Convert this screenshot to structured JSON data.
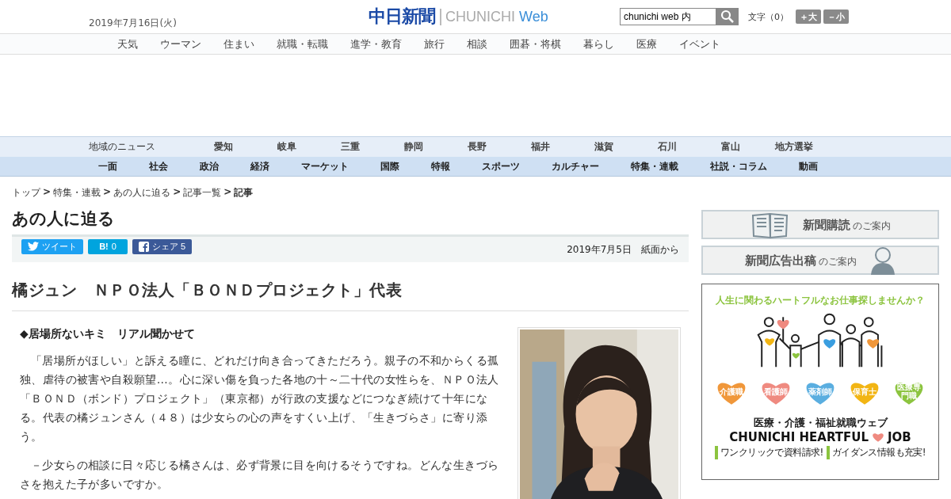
{
  "header": {
    "date": "2019年7月16日(火)",
    "logo_jp": "中日新聞",
    "logo_en": "CHUNICHI",
    "logo_web": "Web",
    "search": {
      "value": "chunichi web 内"
    },
    "font_size": {
      "label": "文字（0）",
      "bigger": "＋大",
      "smaller": "－小"
    }
  },
  "top_nav": [
    "天気",
    "ウーマン",
    "住まい",
    "就職・転職",
    "進学・教育",
    "旅行",
    "相談",
    "囲碁・将棋",
    "暮らし",
    "医療",
    "イベント"
  ],
  "region_nav": {
    "label": "地域のニュース",
    "items": [
      "愛知",
      "岐阜",
      "三重",
      "静岡",
      "長野",
      "福井",
      "滋賀",
      "石川",
      "富山",
      "地方選挙"
    ]
  },
  "category_nav": [
    "一面",
    "社会",
    "政治",
    "経済",
    "マーケット",
    "国際",
    "特報",
    "スポーツ",
    "カルチャー",
    "特集・連載",
    "社説・コラム",
    "動画"
  ],
  "breadcrumb_separator": ">",
  "breadcrumb": [
    {
      "label": "トップ",
      "current": false
    },
    {
      "label": "特集・連載",
      "current": false
    },
    {
      "label": "あの人に迫る",
      "current": false
    },
    {
      "label": "記事一覧",
      "current": false
    },
    {
      "label": "記事",
      "current": true
    }
  ],
  "section_title": "あの人に迫る",
  "share": [
    {
      "kind": "twitter",
      "label": "ツイート"
    },
    {
      "kind": "hatena",
      "label": "B!",
      "count": "0"
    },
    {
      "kind": "facebook",
      "label": "シェア",
      "count": "5"
    }
  ],
  "article_date": "2019年7月5日　紙面から",
  "headline": "橘ジュン　ＮＰＯ法人「ＢＯＮＤプロジェクト」代表",
  "subhead": "◆居場所ないキミ　リアル聞かせて",
  "paragraphs": [
    "「居場所がほしい」と訴える瞳に、どれだけ向き合ってきただろう。親子の不和からくる孤独、虐待の被害や自殺願望…。心に深い傷を負った各地の十～二十代の女性らを、ＮＰＯ法人「ＢＯＮＤ（ボンド）プロジェクト」（東京都）が行政の支援などにつなぎ続けて十年になる。代表の橘ジュンさん（４８）は少女らの心の声をすくい上げ、「生きづらさ」に寄り添う。",
    "－少女らの相談に日々応じる橘さんは、必ず背景に目を向けるそうですね。どんな生きづらさを抱えた子が多いですか。"
  ],
  "sidebar": {
    "banners": [
      {
        "kind": "book",
        "main": "新聞購読",
        "sub": "のご案内"
      },
      {
        "kind": "person",
        "main": "新聞広告出稿",
        "sub": "のご案内"
      }
    ],
    "ad": {
      "tagline": "人生に関わるハートフルなお仕事探しませんか？",
      "hearts": [
        {
          "label": "介護職",
          "color": "#f0973a"
        },
        {
          "label": "看護師",
          "color": "#ef8a80"
        },
        {
          "label": "薬剤師",
          "color": "#5aaee0"
        },
        {
          "label": "保育士",
          "color": "#f2b514"
        },
        {
          "label": "医療専門職",
          "color": "#8cc43f"
        }
      ],
      "title": "医療・介護・福祉就職ウェブ",
      "brand_left": "CHUNICHI HEARTFUL",
      "brand_right": "JOB",
      "notes": [
        "ワンクリックで資料請求!",
        "ガイダンス情報も充実!"
      ]
    }
  }
}
